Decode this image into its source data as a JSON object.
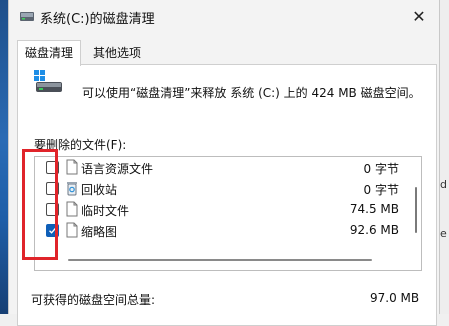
{
  "window": {
    "title": "系统(C:)的磁盘清理",
    "close_glyph": "✕"
  },
  "tabs": [
    {
      "label": "磁盘清理",
      "active": true
    },
    {
      "label": "其他选项",
      "active": false
    }
  ],
  "summary": "可以使用“磁盘清理”来释放 系统 (C:) 上的 424 MB 磁盘空间。",
  "files_label": "要删除的文件(F):",
  "files": [
    {
      "name": "语言资源文件",
      "size": "0 字节",
      "checked": false,
      "icon": "document-icon"
    },
    {
      "name": "回收站",
      "size": "0 字节",
      "checked": false,
      "icon": "recycle-bin-icon"
    },
    {
      "name": "临时文件",
      "size": "74.5 MB",
      "checked": false,
      "icon": "document-icon"
    },
    {
      "name": "缩略图",
      "size": "92.6 MB",
      "checked": true,
      "icon": "document-icon"
    }
  ],
  "total": {
    "label": "可获得的磁盘空间总量:",
    "value": "97.0 MB"
  },
  "background_fragments": [
    "d",
    "e"
  ],
  "colors": {
    "accent": "#0f5fb8",
    "highlight_box": "#e0242a"
  }
}
